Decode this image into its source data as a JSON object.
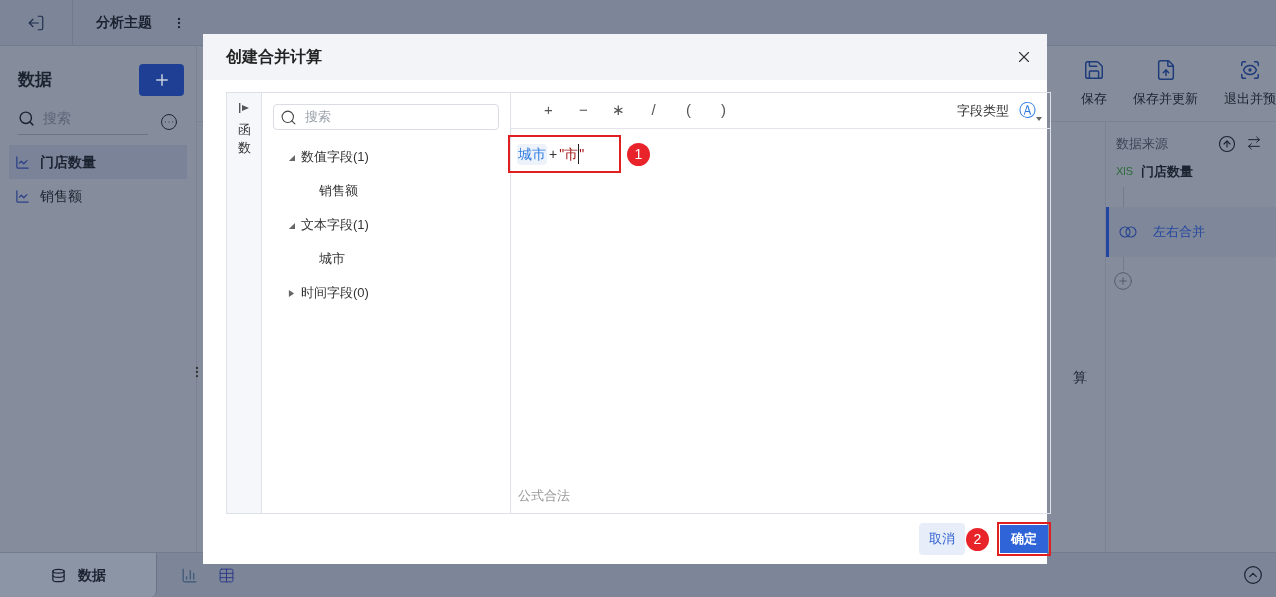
{
  "topbar": {
    "title": "分析主题"
  },
  "sidebar": {
    "title": "数据",
    "search_placeholder": "搜索",
    "items": [
      {
        "label": "门店数量",
        "selected": true
      },
      {
        "label": "销售额",
        "selected": false
      }
    ]
  },
  "toolbar": [
    {
      "kind": "save",
      "label": "保存"
    },
    {
      "kind": "save_update",
      "label": "保存并更新"
    },
    {
      "kind": "preview",
      "label": "退出并预"
    }
  ],
  "flow": {
    "title": "数据来源",
    "source": {
      "badge": "XlS",
      "name": "门店数量"
    },
    "steps": [
      {
        "label": "左右合并",
        "selected": true
      }
    ]
  },
  "canvas_text": "算",
  "bottom_tabs": [
    {
      "label": "数据",
      "selected": true
    }
  ],
  "dialog": {
    "title": "创建合并计算",
    "side_tab": "函数",
    "search_placeholder": "搜索",
    "tree": [
      {
        "label": "数值字段(1)",
        "expanded": true,
        "children": [
          {
            "label": "销售额"
          }
        ]
      },
      {
        "label": "文本字段(1)",
        "expanded": true,
        "children": [
          {
            "label": "城市"
          }
        ]
      },
      {
        "label": "时间字段(0)",
        "expanded": false
      }
    ],
    "operators": [
      "+",
      "−",
      "∗",
      "/",
      "(",
      ")"
    ],
    "field_type": {
      "label": "字段类型",
      "icon": "Ⓐ"
    },
    "formula": [
      {
        "kind": "field",
        "text": "城市"
      },
      {
        "kind": "operator",
        "text": "+"
      },
      {
        "kind": "string",
        "text": "\"市"
      },
      {
        "kind": "cursor"
      },
      {
        "kind": "string",
        "text": "\""
      }
    ],
    "status": "公式合法",
    "buttons": {
      "cancel": "取消",
      "ok": "确定"
    },
    "annotations": [
      "1",
      "2"
    ]
  }
}
